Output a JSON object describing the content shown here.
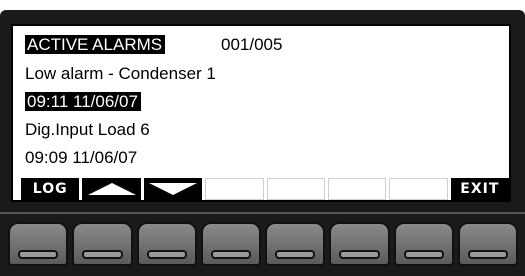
{
  "display": {
    "title": "ACTIVE ALARMS",
    "counter": "001/005",
    "alarms": [
      {
        "description": "Low alarm - Condenser 1",
        "timestamp": "09:11 11/06/07"
      },
      {
        "description": "Dig.Input Load 6",
        "timestamp": "09:09 11/06/07"
      }
    ]
  },
  "softkeys": {
    "log_label": "LOG",
    "exit_label": "EXIT"
  },
  "icons": {
    "up": "up-arrow-icon",
    "down": "down-arrow-icon"
  },
  "colors": {
    "bezel": "#1a1a1a",
    "screen": "#ffffff",
    "key": "#6e6e6e"
  }
}
